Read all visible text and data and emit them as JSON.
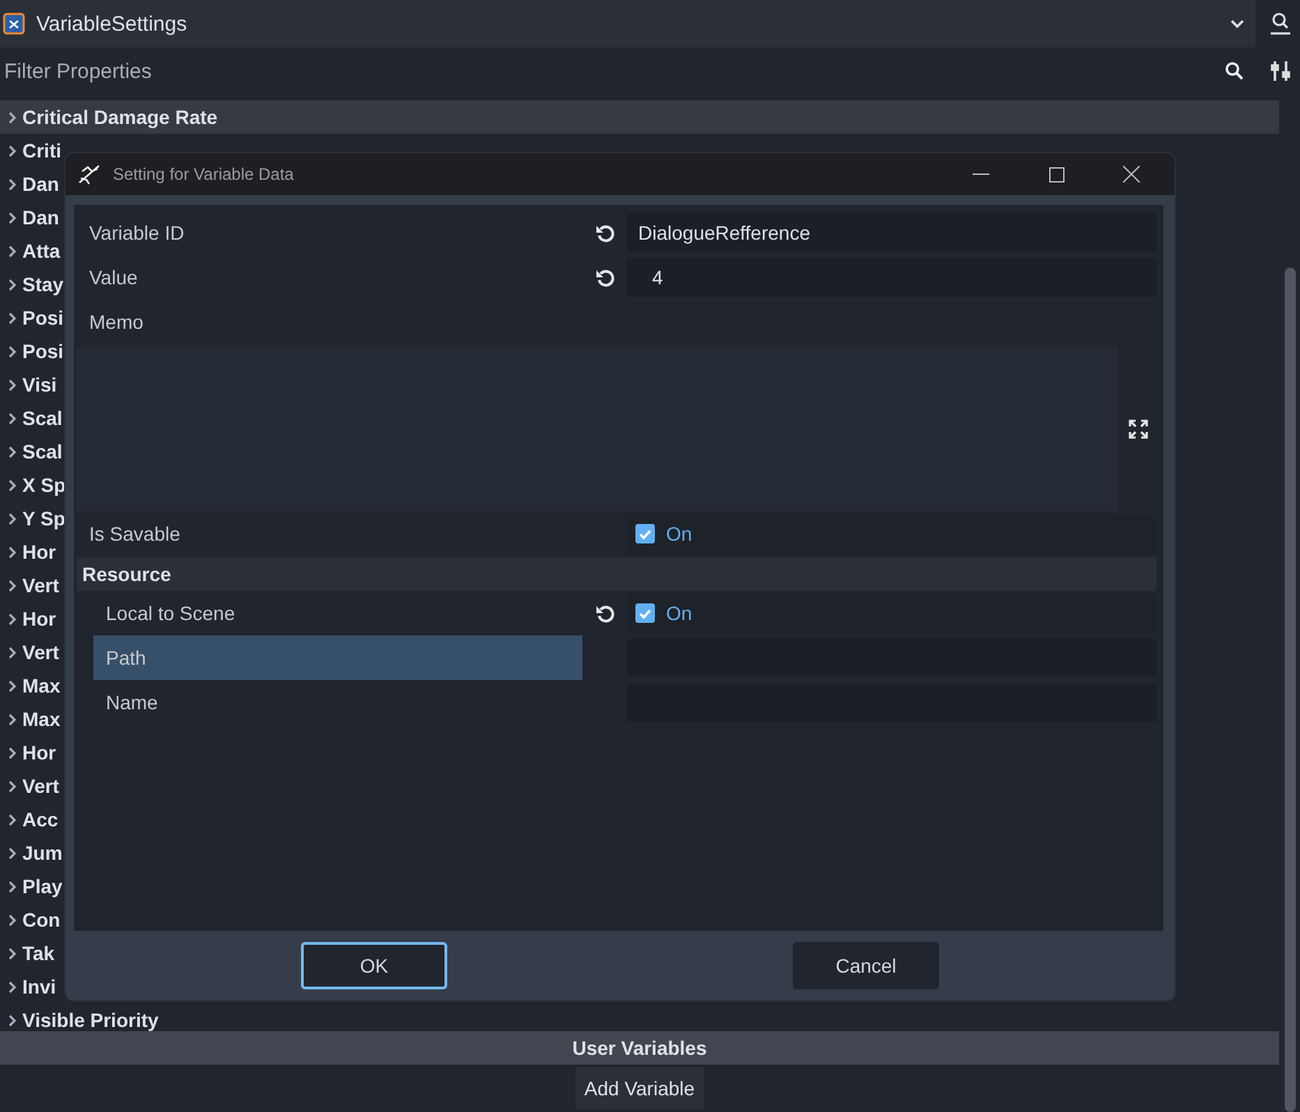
{
  "header": {
    "title": "VariableSettings"
  },
  "filter": {
    "placeholder": "Filter Properties"
  },
  "properties": [
    {
      "label": "Critical Damage Rate",
      "selected": true
    },
    {
      "label": "Criti",
      "selected": false
    },
    {
      "label": "Dan",
      "selected": false
    },
    {
      "label": "Dan",
      "selected": false
    },
    {
      "label": "Atta",
      "selected": false
    },
    {
      "label": "Stay",
      "selected": false
    },
    {
      "label": "Posi",
      "selected": false
    },
    {
      "label": "Posi",
      "selected": false
    },
    {
      "label": "Visi",
      "selected": false
    },
    {
      "label": "Scal",
      "selected": false
    },
    {
      "label": "Scal",
      "selected": false
    },
    {
      "label": "X Sp",
      "selected": false
    },
    {
      "label": "Y Sp",
      "selected": false
    },
    {
      "label": "Hor",
      "selected": false
    },
    {
      "label": "Vert",
      "selected": false
    },
    {
      "label": "Hor",
      "selected": false
    },
    {
      "label": "Vert",
      "selected": false
    },
    {
      "label": "Max",
      "selected": false
    },
    {
      "label": "Max",
      "selected": false
    },
    {
      "label": "Hor",
      "selected": false
    },
    {
      "label": "Vert",
      "selected": false
    },
    {
      "label": "Acc",
      "selected": false
    },
    {
      "label": "Jum",
      "selected": false
    },
    {
      "label": "Play",
      "selected": false
    },
    {
      "label": "Con",
      "selected": false
    },
    {
      "label": "Tak",
      "selected": false
    },
    {
      "label": "Invi",
      "selected": false
    },
    {
      "label": "Visible Priority",
      "selected": false
    }
  ],
  "section": {
    "label": "User Variables"
  },
  "add_button": {
    "label": "Add Variable"
  },
  "dialog": {
    "title": "Setting for Variable Data",
    "fields": [
      {
        "kind": "text",
        "label": "Variable ID",
        "value": "DialogueRefference",
        "revert": true,
        "selected": false
      },
      {
        "kind": "text",
        "label": "Value",
        "value": "4",
        "revert": true,
        "selected": false
      },
      {
        "kind": "memo",
        "label": "Memo",
        "revert": false,
        "selected": false
      },
      {
        "kind": "check",
        "label": "Is Savable",
        "checked": true,
        "value": "On",
        "revert": false,
        "selected": false
      }
    ],
    "group": {
      "label": "Resource",
      "fields": [
        {
          "kind": "check",
          "label": "Local to Scene",
          "checked": true,
          "value": "On",
          "revert": true,
          "selected": false
        },
        {
          "kind": "text",
          "label": "Path",
          "revert": false,
          "selected": true
        },
        {
          "kind": "text",
          "label": "Name",
          "revert": false,
          "selected": false
        }
      ]
    },
    "buttons": [
      {
        "label": "OK",
        "focused": true
      },
      {
        "label": "Cancel",
        "focused": false
      }
    ]
  }
}
